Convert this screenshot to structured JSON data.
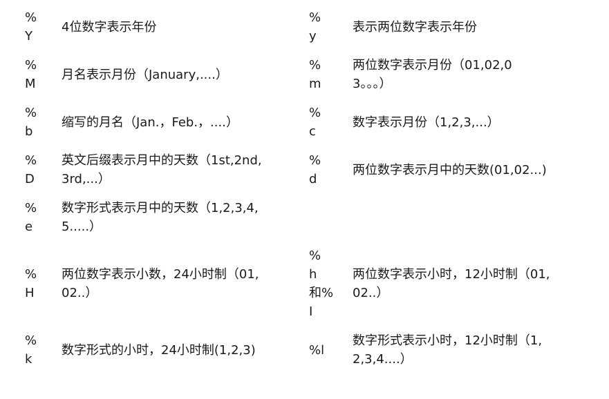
{
  "rows": [
    {
      "code1": "%\nY",
      "desc1": "4位数字表示年份",
      "code2": "%\ny",
      "desc2": "表示两位数字表示年份"
    },
    {
      "code1": "%\nM",
      "desc1": "月名表示月份（January,....）",
      "code2": "%\nm",
      "desc2": "两位数字表示月份（01,02,0\n3。。。）"
    },
    {
      "code1": "%\nb",
      "desc1": "缩写的月名（Jan.，Feb.，....）",
      "code2": "%\nc",
      "desc2": "数字表示月份（1,2,3,...）"
    },
    {
      "code1": "%\nD",
      "desc1": "英文后缀表示月中的天数（1st,2nd,\n3rd,...）",
      "code2": "%\nd",
      "desc2": "两位数字表示月中的天数(01,02...)"
    },
    {
      "code1": "%\ne",
      "desc1": "数字形式表示月中的天数（1,2,3,4,\n5.....）",
      "code2": "",
      "desc2": ""
    },
    {
      "code1": "%\nH",
      "desc1": "两位数字表示小数，24小时制（01,\n02..）",
      "code2": "%\nh\n和%\nI",
      "desc2": "两位数字表示小时，12小时制（01,\n02..）"
    },
    {
      "code1": "%\nk",
      "desc1": "数字形式的小时，24小时制(1,2,3)",
      "code2": "%l",
      "desc2": "数字形式表示小时，12小时制（1,\n2,3,4....）"
    }
  ]
}
